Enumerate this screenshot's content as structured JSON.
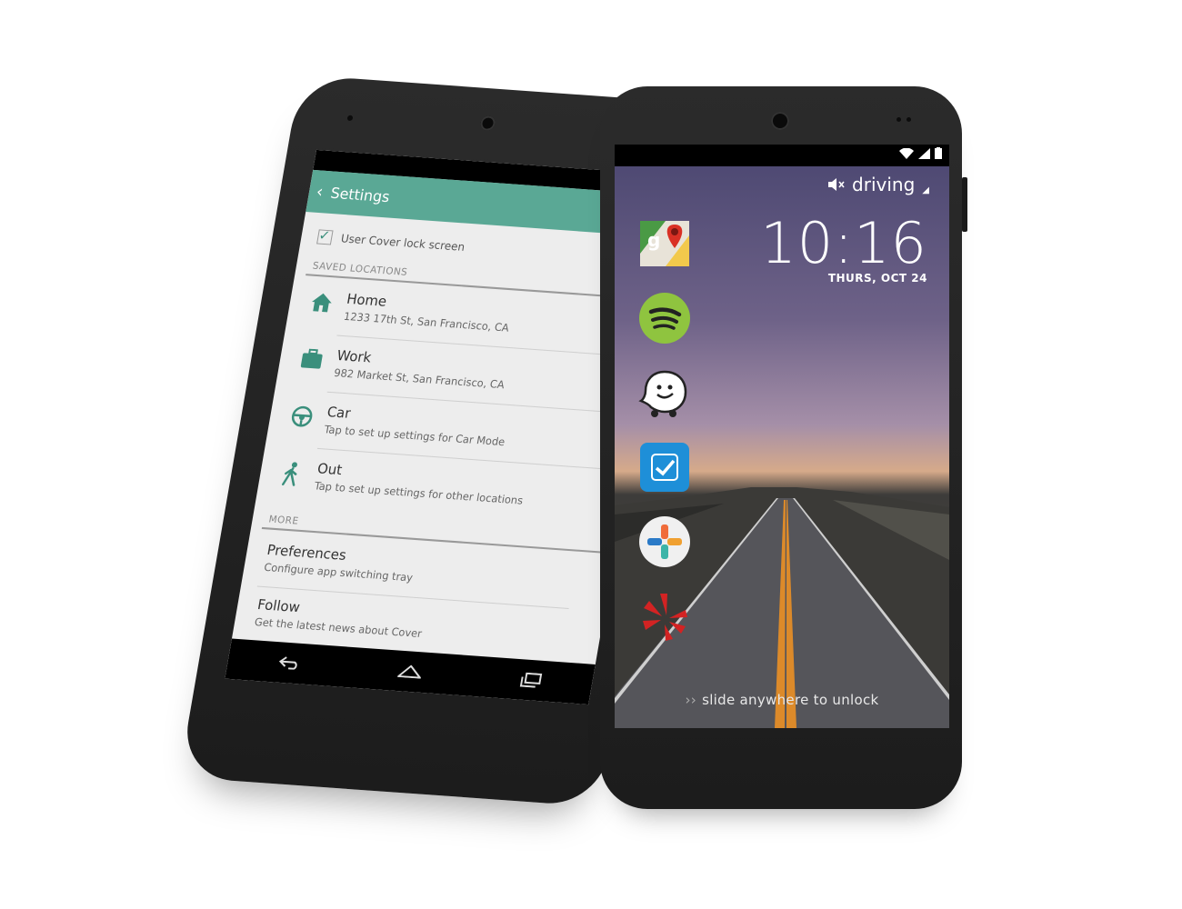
{
  "left_phone": {
    "appbar": {
      "back_icon": "chevron-left-icon",
      "title": "Settings",
      "color": "#5aa895"
    },
    "checkbox_label": "User Cover lock screen",
    "sections": {
      "saved_locations": "SAVED LOCATIONS",
      "more": "MORE"
    },
    "locations": [
      {
        "icon": "home-icon",
        "title": "Home",
        "subtitle": "1233 17th St, San Francisco, CA"
      },
      {
        "icon": "briefcase-icon",
        "title": "Work",
        "subtitle": "982 Market St, San Francisco, CA"
      },
      {
        "icon": "steering-wheel-icon",
        "title": "Car",
        "subtitle": "Tap to set up settings for Car Mode"
      },
      {
        "icon": "walking-person-icon",
        "title": "Out",
        "subtitle": "Tap to set up settings for other locations"
      }
    ],
    "more_items": [
      {
        "title": "Preferences",
        "subtitle": "Configure app switching tray"
      },
      {
        "title": "Follow",
        "subtitle": "Get the latest news about Cover"
      }
    ],
    "navbar": [
      "back-icon",
      "home-icon",
      "recent-apps-icon"
    ]
  },
  "right_phone": {
    "mode_icon": "muted-speaker-icon",
    "mode": "driving",
    "time": "10:16",
    "date": "THURS, OCT 24",
    "apps": [
      {
        "name": "maps-icon",
        "color": "#4a9a45"
      },
      {
        "name": "spotify-icon",
        "color": "#8fc43f"
      },
      {
        "name": "waze-icon",
        "color": "#ffffff"
      },
      {
        "name": "tasks-icon",
        "color": "#1e8fd8"
      },
      {
        "name": "tunein-icon",
        "color": "#f0f0f0"
      },
      {
        "name": "yelp-icon",
        "color": "#d32323"
      }
    ],
    "unlock_text": "slide anywhere to unlock"
  }
}
